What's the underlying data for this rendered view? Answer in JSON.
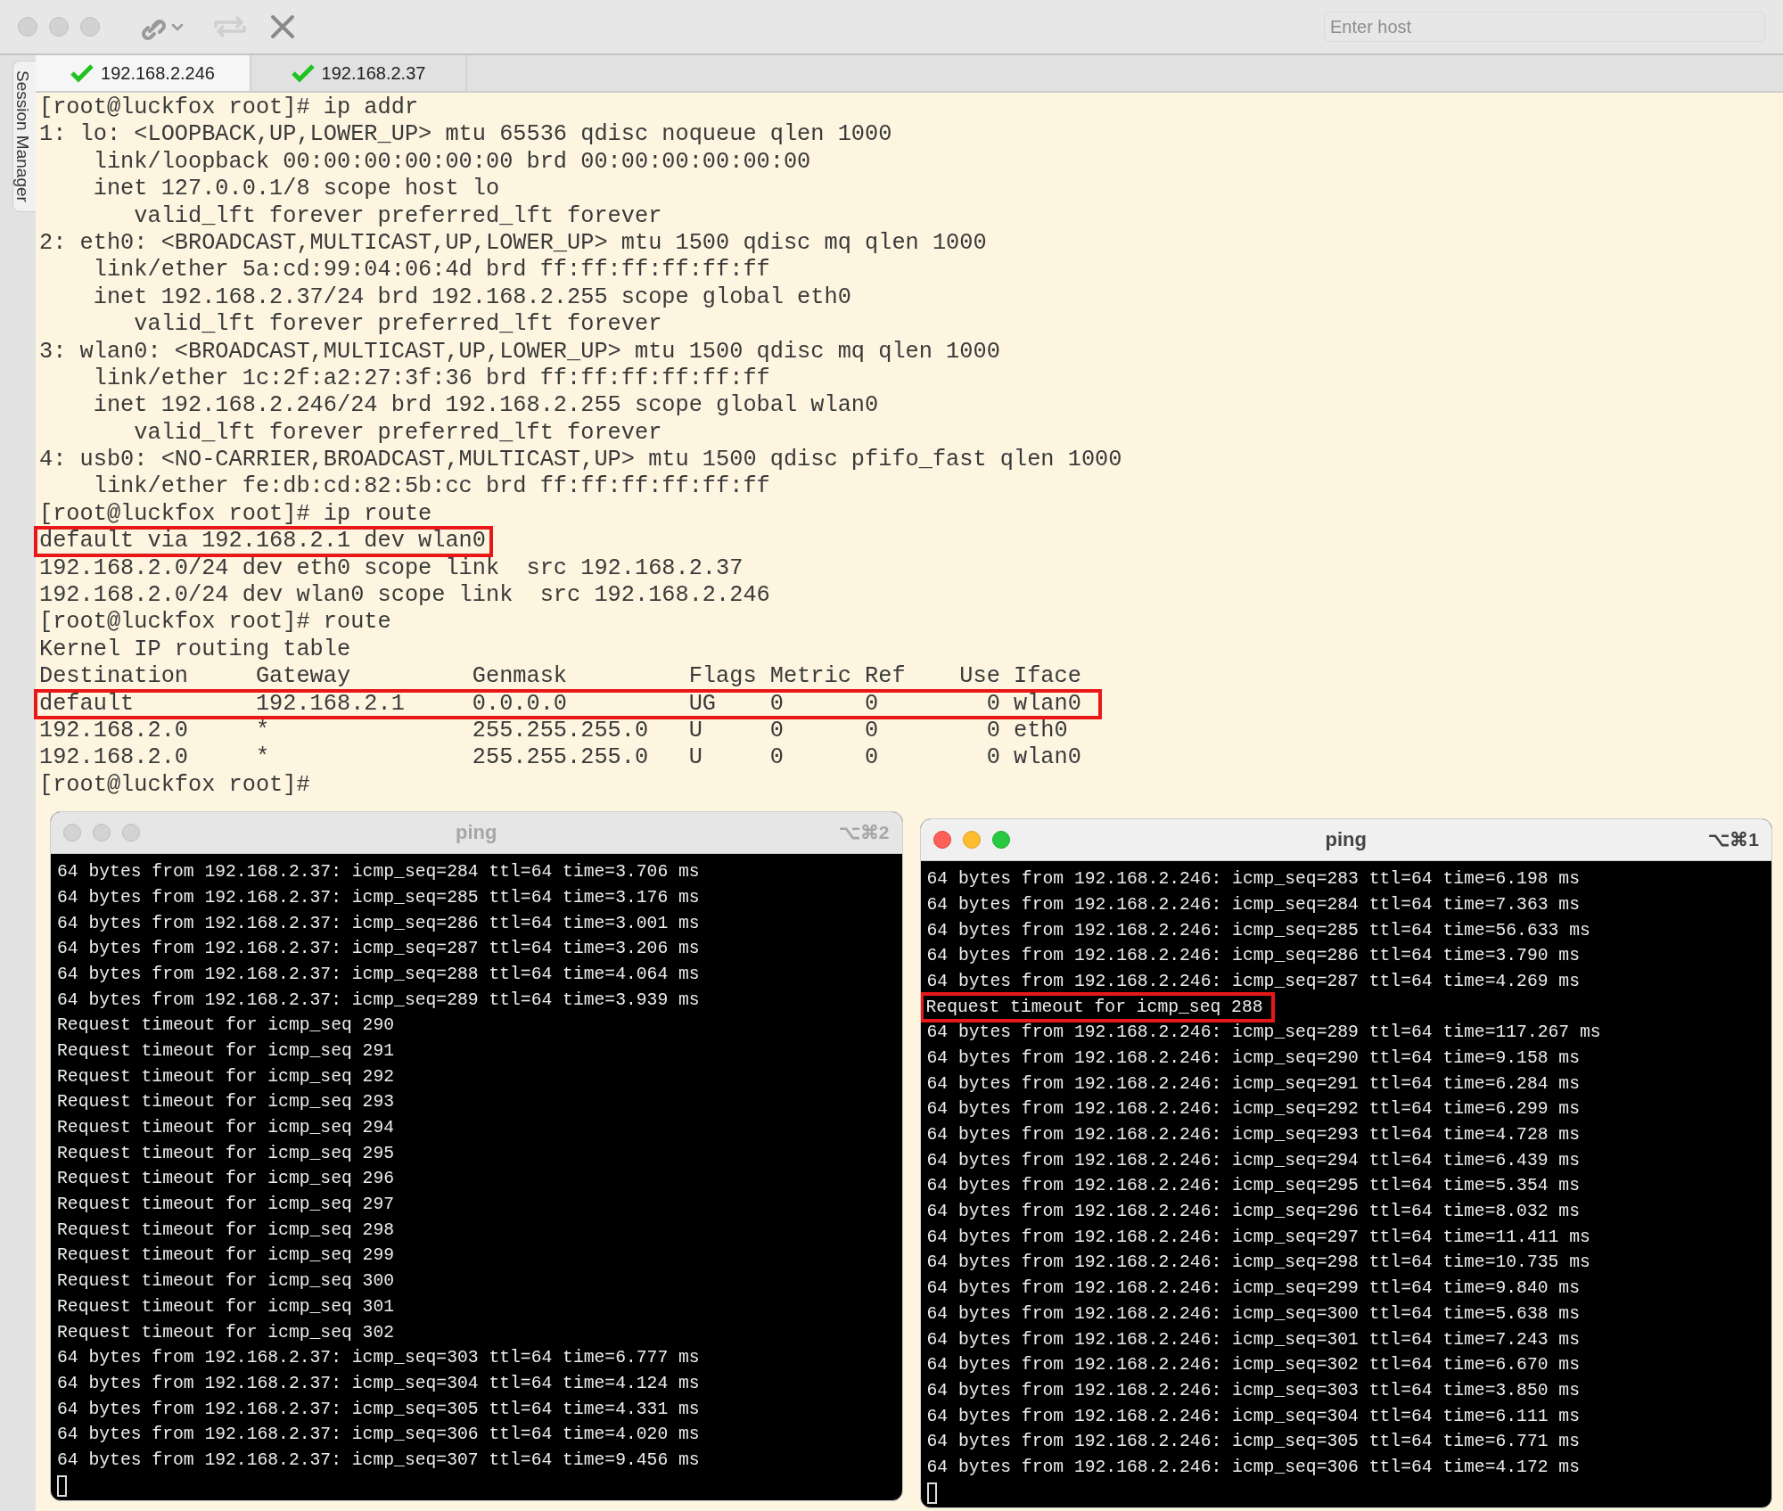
{
  "toolbar": {
    "host_field": {
      "placeholder": "Enter host"
    }
  },
  "session_manager": {
    "label": "Session Manager"
  },
  "tabs": [
    {
      "label": "192.168.2.246",
      "selected": true,
      "connected": true
    },
    {
      "label": "192.168.2.37",
      "selected": false,
      "connected": true
    }
  ],
  "terminal": {
    "lines": [
      {
        "text": "[root@luckfox root]# ip addr",
        "highlighted": false
      },
      {
        "text": "1: lo: <LOOPBACK,UP,LOWER_UP> mtu 65536 qdisc noqueue qlen 1000",
        "highlighted": false
      },
      {
        "text": "    link/loopback 00:00:00:00:00:00 brd 00:00:00:00:00:00",
        "highlighted": false
      },
      {
        "text": "    inet 127.0.0.1/8 scope host lo",
        "highlighted": false
      },
      {
        "text": "       valid_lft forever preferred_lft forever",
        "highlighted": false
      },
      {
        "text": "2: eth0: <BROADCAST,MULTICAST,UP,LOWER_UP> mtu 1500 qdisc mq qlen 1000",
        "highlighted": false
      },
      {
        "text": "    link/ether 5a:cd:99:04:06:4d brd ff:ff:ff:ff:ff:ff",
        "highlighted": false
      },
      {
        "text": "    inet 192.168.2.37/24 brd 192.168.2.255 scope global eth0",
        "highlighted": false
      },
      {
        "text": "       valid_lft forever preferred_lft forever",
        "highlighted": false
      },
      {
        "text": "3: wlan0: <BROADCAST,MULTICAST,UP,LOWER_UP> mtu 1500 qdisc mq qlen 1000",
        "highlighted": false
      },
      {
        "text": "    link/ether 1c:2f:a2:27:3f:36 brd ff:ff:ff:ff:ff:ff",
        "highlighted": false
      },
      {
        "text": "    inet 192.168.2.246/24 brd 192.168.2.255 scope global wlan0",
        "highlighted": false
      },
      {
        "text": "       valid_lft forever preferred_lft forever",
        "highlighted": false
      },
      {
        "text": "4: usb0: <NO-CARRIER,BROADCAST,MULTICAST,UP> mtu 1500 qdisc pfifo_fast qlen 1000",
        "highlighted": false
      },
      {
        "text": "    link/ether fe:db:cd:82:5b:cc brd ff:ff:ff:ff:ff:ff",
        "highlighted": false
      },
      {
        "text": "[root@luckfox root]# ip route",
        "highlighted": false
      },
      {
        "text": "default via 192.168.2.1 dev wlan0",
        "highlighted": true
      },
      {
        "text": "192.168.2.0/24 dev eth0 scope link  src 192.168.2.37",
        "highlighted": false
      },
      {
        "text": "192.168.2.0/24 dev wlan0 scope link  src 192.168.2.246",
        "highlighted": false
      },
      {
        "text": "[root@luckfox root]# route",
        "highlighted": false
      },
      {
        "text": "Kernel IP routing table",
        "highlighted": false
      },
      {
        "text": "Destination     Gateway         Genmask         Flags Metric Ref    Use Iface",
        "highlighted": false
      },
      {
        "text": "default         192.168.2.1     0.0.0.0         UG    0      0        0 wlan0 ",
        "highlighted": true
      },
      {
        "text": "192.168.2.0     *               255.255.255.0   U     0      0        0 eth0",
        "highlighted": false
      },
      {
        "text": "192.168.2.0     *               255.255.255.0   U     0      0        0 wlan0",
        "highlighted": false
      },
      {
        "text": "[root@luckfox root]#",
        "highlighted": false
      }
    ]
  },
  "ping_windows": [
    {
      "title": "ping",
      "shortcut": "⌥⌘2",
      "active": false,
      "lines": [
        {
          "text": "64 bytes from 192.168.2.37: icmp_seq=284 ttl=64 time=3.706 ms",
          "highlighted": false
        },
        {
          "text": "64 bytes from 192.168.2.37: icmp_seq=285 ttl=64 time=3.176 ms",
          "highlighted": false
        },
        {
          "text": "64 bytes from 192.168.2.37: icmp_seq=286 ttl=64 time=3.001 ms",
          "highlighted": false
        },
        {
          "text": "64 bytes from 192.168.2.37: icmp_seq=287 ttl=64 time=3.206 ms",
          "highlighted": false
        },
        {
          "text": "64 bytes from 192.168.2.37: icmp_seq=288 ttl=64 time=4.064 ms",
          "highlighted": false
        },
        {
          "text": "64 bytes from 192.168.2.37: icmp_seq=289 ttl=64 time=3.939 ms",
          "highlighted": false
        },
        {
          "text": "Request timeout for icmp_seq 290",
          "highlighted": false
        },
        {
          "text": "Request timeout for icmp_seq 291",
          "highlighted": false
        },
        {
          "text": "Request timeout for icmp_seq 292",
          "highlighted": false
        },
        {
          "text": "Request timeout for icmp_seq 293",
          "highlighted": false
        },
        {
          "text": "Request timeout for icmp_seq 294",
          "highlighted": false
        },
        {
          "text": "Request timeout for icmp_seq 295",
          "highlighted": false
        },
        {
          "text": "Request timeout for icmp_seq 296",
          "highlighted": false
        },
        {
          "text": "Request timeout for icmp_seq 297",
          "highlighted": false
        },
        {
          "text": "Request timeout for icmp_seq 298",
          "highlighted": false
        },
        {
          "text": "Request timeout for icmp_seq 299",
          "highlighted": false
        },
        {
          "text": "Request timeout for icmp_seq 300",
          "highlighted": false
        },
        {
          "text": "Request timeout for icmp_seq 301",
          "highlighted": false
        },
        {
          "text": "Request timeout for icmp_seq 302",
          "highlighted": false
        },
        {
          "text": "64 bytes from 192.168.2.37: icmp_seq=303 ttl=64 time=6.777 ms",
          "highlighted": false
        },
        {
          "text": "64 bytes from 192.168.2.37: icmp_seq=304 ttl=64 time=4.124 ms",
          "highlighted": false
        },
        {
          "text": "64 bytes from 192.168.2.37: icmp_seq=305 ttl=64 time=4.331 ms",
          "highlighted": false
        },
        {
          "text": "64 bytes from 192.168.2.37: icmp_seq=306 ttl=64 time=4.020 ms",
          "highlighted": false
        },
        {
          "text": "64 bytes from 192.168.2.37: icmp_seq=307 ttl=64 time=9.456 ms",
          "highlighted": false
        }
      ]
    },
    {
      "title": "ping",
      "shortcut": "⌥⌘1",
      "active": true,
      "lines": [
        {
          "text": "64 bytes from 192.168.2.246: icmp_seq=283 ttl=64 time=6.198 ms",
          "highlighted": false
        },
        {
          "text": "64 bytes from 192.168.2.246: icmp_seq=284 ttl=64 time=7.363 ms",
          "highlighted": false
        },
        {
          "text": "64 bytes from 192.168.2.246: icmp_seq=285 ttl=64 time=56.633 ms",
          "highlighted": false
        },
        {
          "text": "64 bytes from 192.168.2.246: icmp_seq=286 ttl=64 time=3.790 ms",
          "highlighted": false
        },
        {
          "text": "64 bytes from 192.168.2.246: icmp_seq=287 ttl=64 time=4.269 ms",
          "highlighted": false
        },
        {
          "text": "Request timeout for icmp_seq 288",
          "highlighted": true
        },
        {
          "text": "64 bytes from 192.168.2.246: icmp_seq=289 ttl=64 time=117.267 ms",
          "highlighted": false
        },
        {
          "text": "64 bytes from 192.168.2.246: icmp_seq=290 ttl=64 time=9.158 ms",
          "highlighted": false
        },
        {
          "text": "64 bytes from 192.168.2.246: icmp_seq=291 ttl=64 time=6.284 ms",
          "highlighted": false
        },
        {
          "text": "64 bytes from 192.168.2.246: icmp_seq=292 ttl=64 time=6.299 ms",
          "highlighted": false
        },
        {
          "text": "64 bytes from 192.168.2.246: icmp_seq=293 ttl=64 time=4.728 ms",
          "highlighted": false
        },
        {
          "text": "64 bytes from 192.168.2.246: icmp_seq=294 ttl=64 time=6.439 ms",
          "highlighted": false
        },
        {
          "text": "64 bytes from 192.168.2.246: icmp_seq=295 ttl=64 time=5.354 ms",
          "highlighted": false
        },
        {
          "text": "64 bytes from 192.168.2.246: icmp_seq=296 ttl=64 time=8.032 ms",
          "highlighted": false
        },
        {
          "text": "64 bytes from 192.168.2.246: icmp_seq=297 ttl=64 time=11.411 ms",
          "highlighted": false
        },
        {
          "text": "64 bytes from 192.168.2.246: icmp_seq=298 ttl=64 time=10.735 ms",
          "highlighted": false
        },
        {
          "text": "64 bytes from 192.168.2.246: icmp_seq=299 ttl=64 time=9.840 ms",
          "highlighted": false
        },
        {
          "text": "64 bytes from 192.168.2.246: icmp_seq=300 ttl=64 time=5.638 ms",
          "highlighted": false
        },
        {
          "text": "64 bytes from 192.168.2.246: icmp_seq=301 ttl=64 time=7.243 ms",
          "highlighted": false
        },
        {
          "text": "64 bytes from 192.168.2.246: icmp_seq=302 ttl=64 time=6.670 ms",
          "highlighted": false
        },
        {
          "text": "64 bytes from 192.168.2.246: icmp_seq=303 ttl=64 time=3.850 ms",
          "highlighted": false
        },
        {
          "text": "64 bytes from 192.168.2.246: icmp_seq=304 ttl=64 time=6.111 ms",
          "highlighted": false
        },
        {
          "text": "64 bytes from 192.168.2.246: icmp_seq=305 ttl=64 time=6.771 ms",
          "highlighted": false
        },
        {
          "text": "64 bytes from 192.168.2.246: icmp_seq=306 ttl=64 time=4.172 ms",
          "highlighted": false
        }
      ]
    }
  ]
}
